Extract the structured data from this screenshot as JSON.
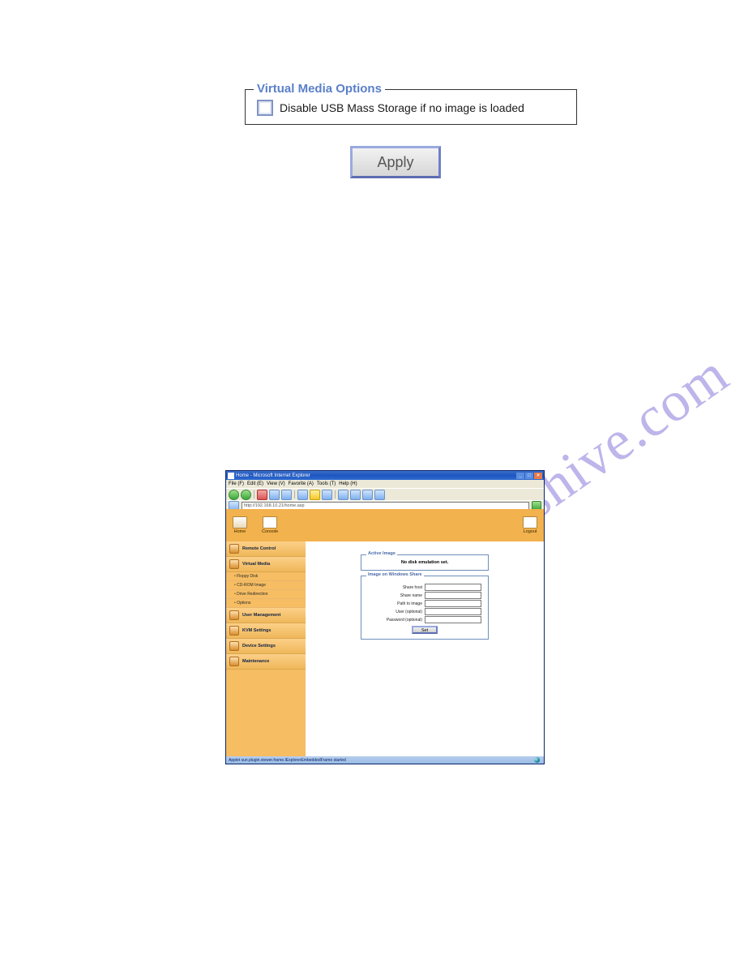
{
  "vm_options": {
    "legend": "Virtual Media Options",
    "checkbox_label": "Disable USB Mass Storage if no image is loaded"
  },
  "apply_label": "Apply",
  "watermark": "manualshive.com",
  "ie": {
    "title": "Home - Microsoft Internet Explorer",
    "menu": {
      "file": "File (F)",
      "edit": "Edit (E)",
      "view": "View (V)",
      "favorites": "Favorite (A)",
      "tools": "Tools (T)",
      "help": "Help (H)"
    },
    "address": "http://192.168.10.21/home.asp",
    "status": "Applet sun.plugin.viewer.frame.IExplorerEmbeddedFrame started"
  },
  "kvm": {
    "header": {
      "home": "Home",
      "console": "Console",
      "logout": "Logout"
    },
    "sidebar": {
      "remote_control": "Remote Control",
      "virtual_media": "Virtual Media",
      "sub_floppy": "Floppy Disk",
      "sub_cdrom": "CD-ROM Image",
      "sub_drive": "Drive Redirection",
      "sub_options": "Options",
      "user_mgmt": "User Management",
      "kvm_settings": "KVM Settings",
      "device_settings": "Device Settings",
      "maintenance": "Maintenance"
    },
    "content": {
      "active_image_legend": "Active Image",
      "active_image_text": "No disk emulation set.",
      "win_share_legend": "Image on Windows Share",
      "share_host": "Share host",
      "share_name": "Share name",
      "path_to_image": "Path to image",
      "user_optional": "User (optional)",
      "password_optional": "Password (optional)",
      "set_button": "Set"
    }
  }
}
